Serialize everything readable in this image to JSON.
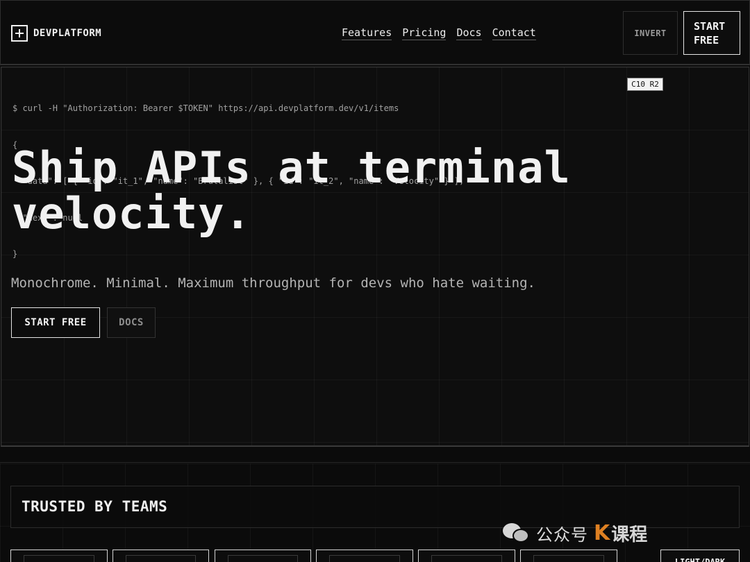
{
  "header": {
    "logo_text": "DEVPLATFORM",
    "nav": [
      "Features",
      "Pricing",
      "Docs",
      "Contact"
    ],
    "invert_label": "INVERT",
    "start_label": "START\nFREE"
  },
  "hero": {
    "code_lines": [
      "$ curl -H \"Authorization: Bearer $TOKEN\" https://api.devplatform.dev/v1/items",
      "{",
      "  \"data\": [ { \"id\": \"it_1\", \"name\": \"Brutalist\" }, { \"id\": \"it_2\", \"name\": \"Velocity\" } ],",
      "  \"next\": null",
      "}"
    ],
    "grid_tag": "C10 R2",
    "title_line1": "Ship APIs at terminal",
    "title_line2": "velocity.",
    "subtitle": "Monochrome. Minimal. Maximum throughput for devs who hate waiting.",
    "start_label": "START FREE",
    "docs_label": "DOCS"
  },
  "trusted": {
    "title": "TRUSTED BY TEAMS",
    "toggle_label": "LIGHT/DARK"
  },
  "watermark": {
    "text": "公众号",
    "brand": "课程"
  },
  "colors": {
    "background": "#0b0b0b",
    "text": "#ececec",
    "muted": "#a2a2a2",
    "border": "#2e2e2e",
    "watermark_accent": "#f08a24"
  }
}
